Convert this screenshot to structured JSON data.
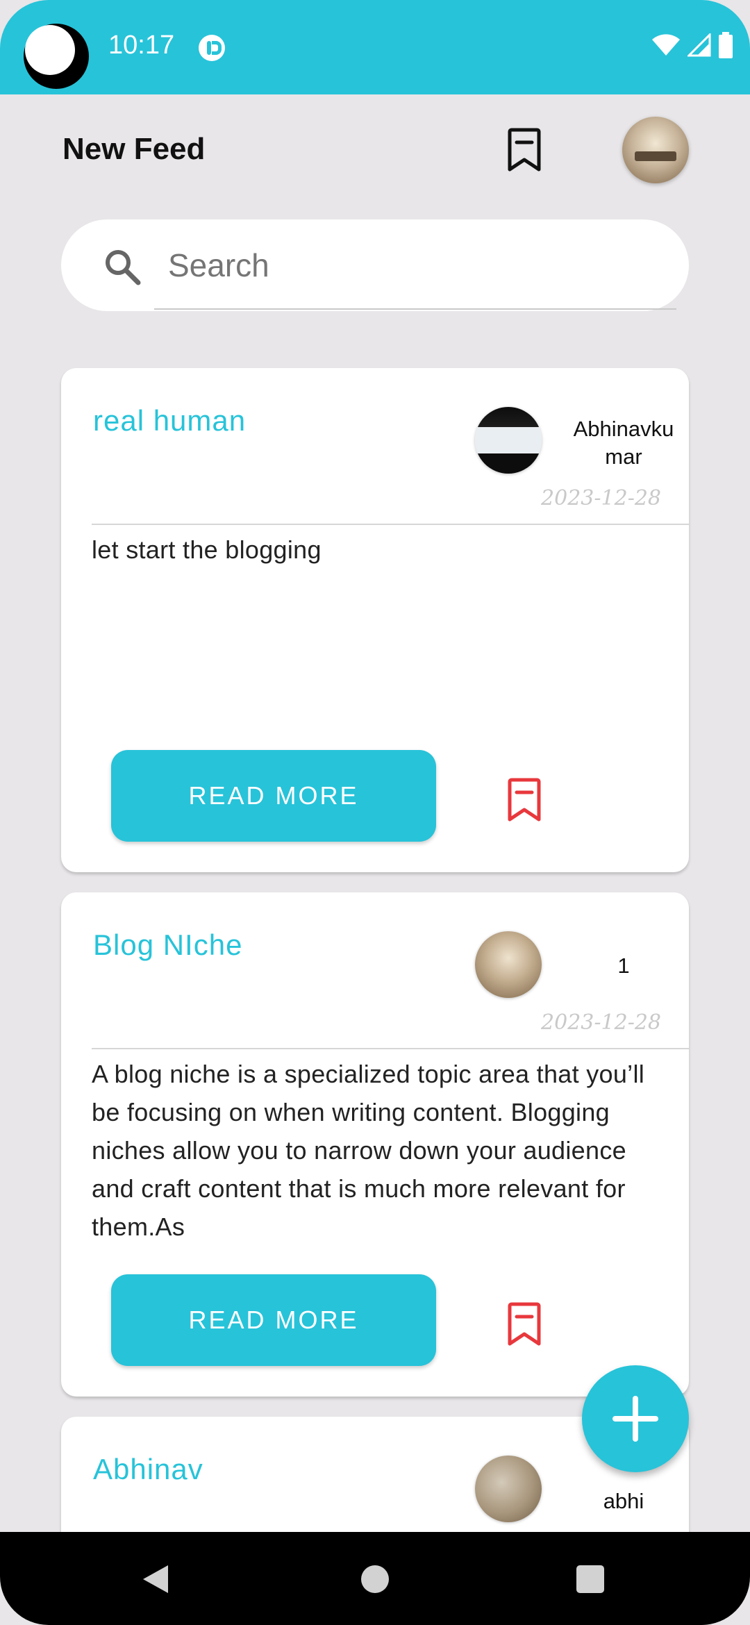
{
  "status_bar": {
    "time": "10:17",
    "icons": [
      "wifi-icon",
      "signal-icon",
      "battery-icon"
    ]
  },
  "header": {
    "title": "New Feed",
    "bookmark_icon": "bookmark-icon",
    "avatar": "profile-avatar"
  },
  "search": {
    "placeholder": "Search",
    "icon": "search-icon"
  },
  "posts": [
    {
      "title": "real human",
      "author": "Abhinavkumar",
      "date": "2023-12-28",
      "body": "let start the blogging",
      "read_more_label": "READ MORE"
    },
    {
      "title": "Blog NIche",
      "author": "1",
      "date": "2023-12-28",
      "body": "A blog niche is a specialized topic area that you’ll be focusing on when writing content. Blogging niches allow you to narrow down your audience and craft content that is much more relevant for them.As",
      "read_more_label": "READ MORE"
    },
    {
      "title": "Abhinav",
      "author": "abhi"
    }
  ],
  "fab": {
    "icon": "plus-icon"
  },
  "colors": {
    "accent": "#27c3d9",
    "background": "#e8e6e8",
    "bookmark_red": "#e8383d"
  }
}
